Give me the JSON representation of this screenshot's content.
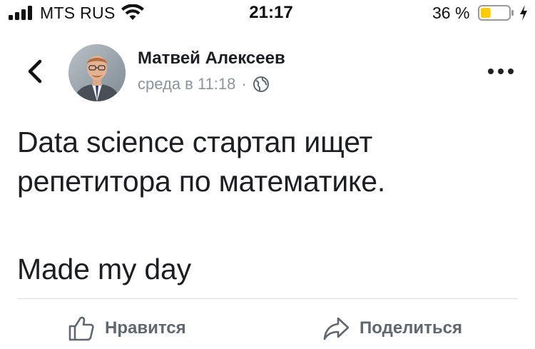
{
  "status_bar": {
    "carrier": "MTS RUS",
    "time": "21:17",
    "battery_percent": "36 %",
    "battery_level": 0.36,
    "battery_color": "#ffcc00"
  },
  "post": {
    "author": "Матвей Алексеев",
    "timestamp": "среда в 11:18",
    "separator": "·",
    "privacy_icon": "globe-icon",
    "lines": [
      "Data science стартап ищет",
      "репетитора по математике.",
      "Made my day"
    ]
  },
  "actions": {
    "like_label": "Нравится",
    "share_label": "Поделиться"
  },
  "colors": {
    "text": "#1c1e21",
    "secondary_text": "#8d949e",
    "action_text": "#606770",
    "divider": "#dadde1"
  }
}
